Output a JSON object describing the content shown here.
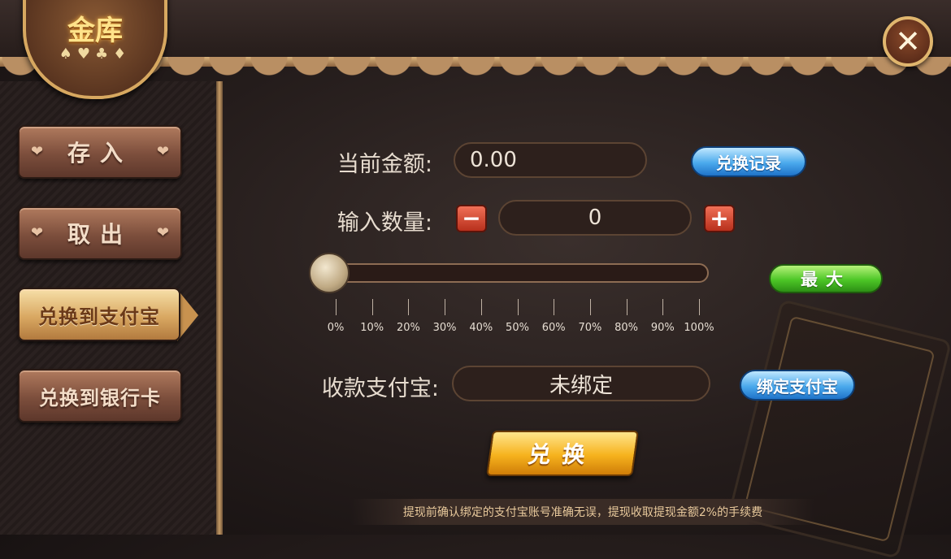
{
  "header": {
    "logo_text": "金库",
    "close_icon": "close-icon"
  },
  "sidebar": {
    "items": [
      {
        "label": "存入",
        "active": false
      },
      {
        "label": "取出",
        "active": false
      },
      {
        "label": "兑换到支付宝",
        "active": true
      },
      {
        "label": "兑换到银行卡",
        "active": false
      }
    ]
  },
  "form": {
    "current_amount_label": "当前金额:",
    "current_amount_value": "0.00",
    "exchange_record_label": "兑换记录",
    "input_qty_label": "输入数量:",
    "input_qty_value": "0",
    "minus_label": "−",
    "plus_label": "+",
    "max_label": "最大",
    "slider": {
      "value_fraction": 0,
      "ticks": [
        "0%",
        "10%",
        "20%",
        "30%",
        "40%",
        "50%",
        "60%",
        "70%",
        "80%",
        "90%",
        "100%"
      ]
    },
    "alipay_label": "收款支付宝:",
    "alipay_value": "未绑定",
    "bind_alipay_label": "绑定支付宝",
    "exchange_button_label": "兑换"
  },
  "notice": "提现前确认绑定的支付宝账号准确无误，提现收取提现金额2%的手续费",
  "colors": {
    "gold": "#f6b21d",
    "blue": "#4aa9ec",
    "green": "#4cc626",
    "red": "#b8301c"
  }
}
